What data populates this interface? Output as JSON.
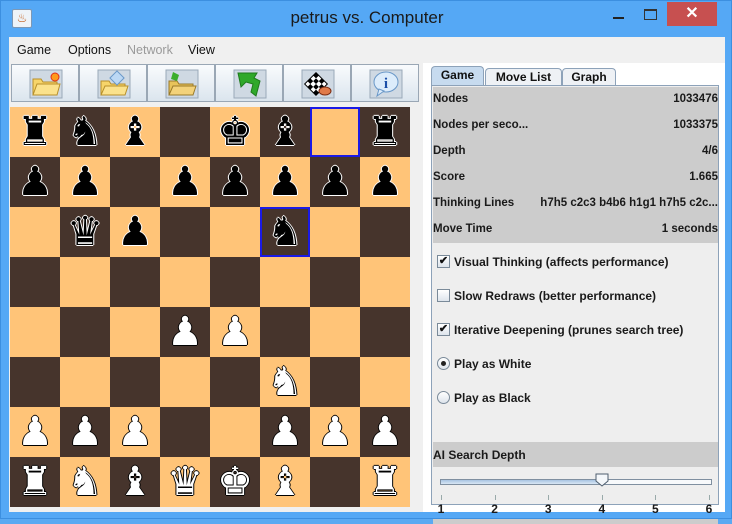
{
  "window": {
    "title": "petrus vs. Computer",
    "app_icon": "java-icon",
    "controls": {
      "minimize": "minimize",
      "maximize": "maximize",
      "close": "✕"
    }
  },
  "menubar": {
    "items": [
      {
        "label": "Game",
        "enabled": true
      },
      {
        "label": "Options",
        "enabled": true
      },
      {
        "label": "Network",
        "enabled": false
      },
      {
        "label": "View",
        "enabled": true
      }
    ]
  },
  "toolbar": {
    "buttons": [
      {
        "name": "new-game",
        "icon": "new-folder-icon"
      },
      {
        "name": "open-game",
        "icon": "open-folder-icon"
      },
      {
        "name": "save-game",
        "icon": "save-folder-icon"
      },
      {
        "name": "undo-move",
        "icon": "undo-arrow-icon"
      },
      {
        "name": "edit-board",
        "icon": "board-edit-icon"
      },
      {
        "name": "about",
        "icon": "info-icon"
      }
    ]
  },
  "board": {
    "ranks": [
      [
        "r",
        "n",
        "b",
        "",
        "k",
        "b",
        "",
        "r"
      ],
      [
        "p",
        "p",
        "",
        "p",
        "p",
        "p",
        "p",
        "p"
      ],
      [
        "",
        "q",
        "p",
        "",
        "",
        "n",
        "",
        ""
      ],
      [
        "",
        "",
        "",
        "",
        "",
        "",
        "",
        ""
      ],
      [
        "",
        "",
        "",
        "P",
        "P",
        "",
        "",
        ""
      ],
      [
        "",
        "",
        "",
        "",
        "",
        "N",
        "",
        ""
      ],
      [
        "P",
        "P",
        "P",
        "",
        "",
        "P",
        "P",
        "P"
      ],
      [
        "R",
        "N",
        "B",
        "Q",
        "K",
        "B",
        "",
        "R"
      ]
    ],
    "last_move_from": "g8",
    "last_move_to": "f6",
    "light_color": "#ffc478",
    "dark_color": "#46342c",
    "highlight_color": "#1a1ae6"
  },
  "panel": {
    "tabs": [
      {
        "label": "Game",
        "active": true
      },
      {
        "label": "Move List",
        "active": false
      },
      {
        "label": "Graph",
        "active": false
      }
    ],
    "stats": [
      {
        "label": "Nodes",
        "value": "1033476"
      },
      {
        "label": "Nodes per seco...",
        "value": "1033375"
      },
      {
        "label": "Depth",
        "value": "4/6"
      },
      {
        "label": "Score",
        "value": "1.665"
      },
      {
        "label": "Thinking Lines",
        "value": "h7h5 c2c3 b4b6 h1g1 h7h5 c2c..."
      },
      {
        "label": "Move Time",
        "value": "1 seconds"
      }
    ],
    "options": [
      {
        "type": "checkbox",
        "label": "Visual Thinking (affects performance)",
        "checked": true
      },
      {
        "type": "checkbox",
        "label": "Slow Redraws (better performance)",
        "checked": false
      },
      {
        "type": "checkbox",
        "label": "Iterative Deepening (prunes search tree)",
        "checked": true
      },
      {
        "type": "radio",
        "label": "Play as White",
        "checked": true
      },
      {
        "type": "radio",
        "label": "Play as Black",
        "checked": false
      }
    ],
    "depth": {
      "label": "AI Search Depth",
      "min": 1,
      "max": 6,
      "value": 4,
      "ticks": [
        "1",
        "2",
        "3",
        "4",
        "5",
        "6"
      ]
    }
  }
}
